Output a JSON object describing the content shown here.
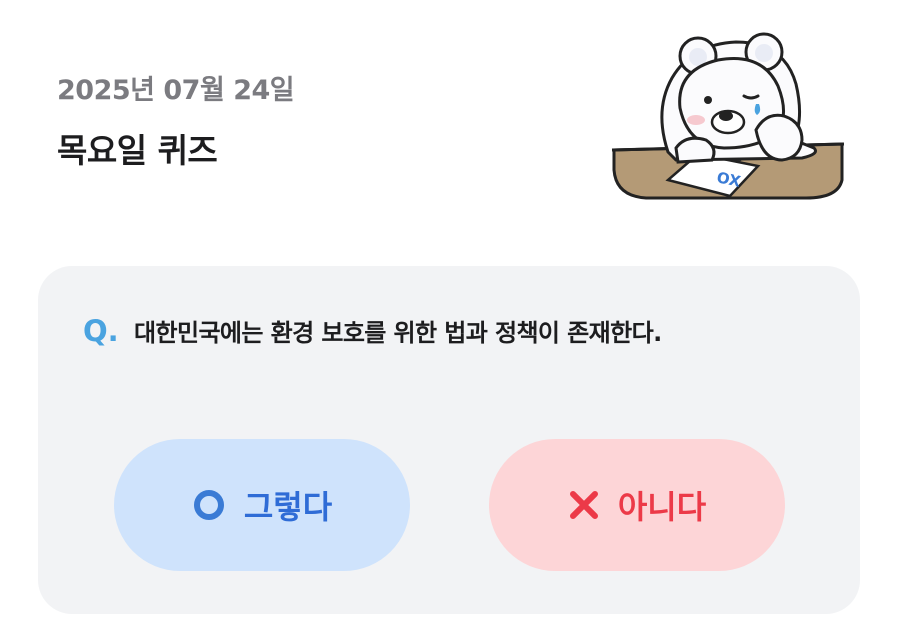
{
  "header": {
    "date": "2025년 07월 24일",
    "title": "목요일 퀴즈"
  },
  "quiz": {
    "q_label": "Q.",
    "question": "대한민국에는 환경 보호를 위한 법과 정책이 존재한다.",
    "answers": {
      "yes": {
        "label": "그렇다",
        "icon": "circle-o-icon",
        "color": "#2f6cd6",
        "bg": "#cfe3fc"
      },
      "no": {
        "label": "아니다",
        "icon": "cross-x-icon",
        "color": "#ec3a48",
        "bg": "#fdd5d7"
      }
    }
  },
  "mascot": {
    "paper_text": "OX",
    "icon": "bear-mascot-icon"
  },
  "colors": {
    "accent_q": "#4aa3e0",
    "card_bg": "#f2f3f5",
    "title": "#1d1d1f",
    "date": "#7b7b80"
  }
}
